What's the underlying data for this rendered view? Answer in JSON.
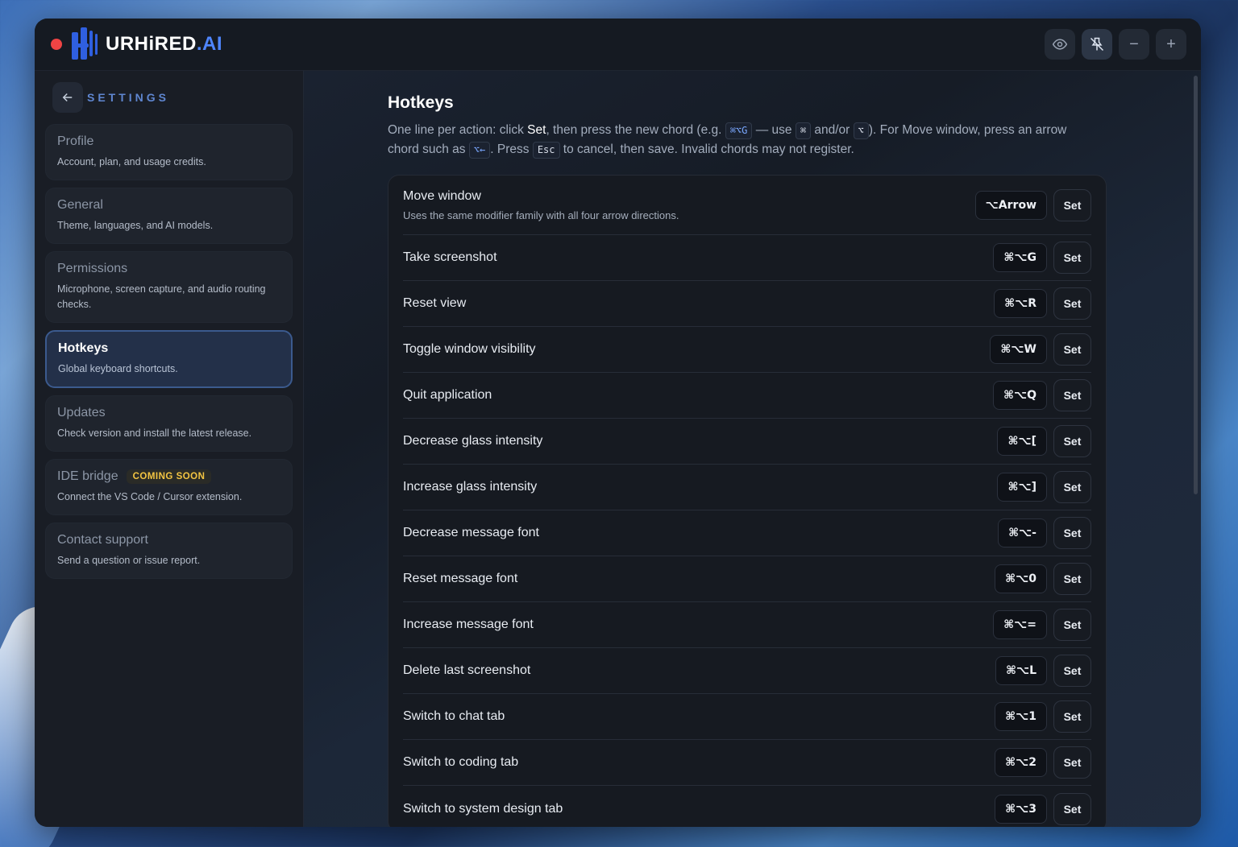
{
  "app": {
    "brand_prefix": "URHiRED",
    "brand_suffix": ".AI"
  },
  "colors": {
    "accent": "#4f86ff",
    "badge": "#f4c542",
    "close": "#ef4444"
  },
  "sidebar": {
    "heading": "SETTINGS",
    "items": [
      {
        "title": "Profile",
        "desc": "Account, plan, and usage credits."
      },
      {
        "title": "General",
        "desc": "Theme, languages, and AI models."
      },
      {
        "title": "Permissions",
        "desc": "Microphone, screen capture, and audio routing checks."
      },
      {
        "title": "Hotkeys",
        "desc": "Global keyboard shortcuts."
      },
      {
        "title": "Updates",
        "desc": "Check version and install the latest release."
      },
      {
        "title": "IDE bridge",
        "badge": "COMING SOON",
        "desc": "Connect the VS Code / Cursor extension."
      },
      {
        "title": "Contact support",
        "desc": "Send a question or issue report."
      }
    ]
  },
  "main": {
    "title": "Hotkeys",
    "desc": {
      "p1": "One line per action: click ",
      "set": "Set",
      "p2": ", then press the new chord (e.g. ",
      "kbd_example": "⌘⌥G",
      "p3": " — use ",
      "kbd_cmd": "⌘",
      "p4": " and/or ",
      "kbd_opt": "⌥",
      "p5": "). For Move window, press an arrow chord such as ",
      "kbd_arrow": "⌥←",
      "p6": ". Press ",
      "kbd_esc": "Esc",
      "p7": " to cancel, then save. Invalid chords may not register."
    },
    "set_label": "Set",
    "hotkeys": [
      {
        "label": "Move window",
        "sub": "Uses the same modifier family with all four arrow directions.",
        "chord": "⌥Arrow"
      },
      {
        "label": "Take screenshot",
        "chord": "⌘⌥G"
      },
      {
        "label": "Reset view",
        "chord": "⌘⌥R"
      },
      {
        "label": "Toggle window visibility",
        "chord": "⌘⌥W"
      },
      {
        "label": "Quit application",
        "chord": "⌘⌥Q"
      },
      {
        "label": "Decrease glass intensity",
        "chord": "⌘⌥["
      },
      {
        "label": "Increase glass intensity",
        "chord": "⌘⌥]"
      },
      {
        "label": "Decrease message font",
        "chord": "⌘⌥-"
      },
      {
        "label": "Reset message font",
        "chord": "⌘⌥0"
      },
      {
        "label": "Increase message font",
        "chord": "⌘⌥="
      },
      {
        "label": "Delete last screenshot",
        "chord": "⌘⌥L"
      },
      {
        "label": "Switch to chat tab",
        "chord": "⌘⌥1"
      },
      {
        "label": "Switch to coding tab",
        "chord": "⌘⌥2"
      },
      {
        "label": "Switch to system design tab",
        "chord": "⌘⌥3"
      }
    ]
  }
}
